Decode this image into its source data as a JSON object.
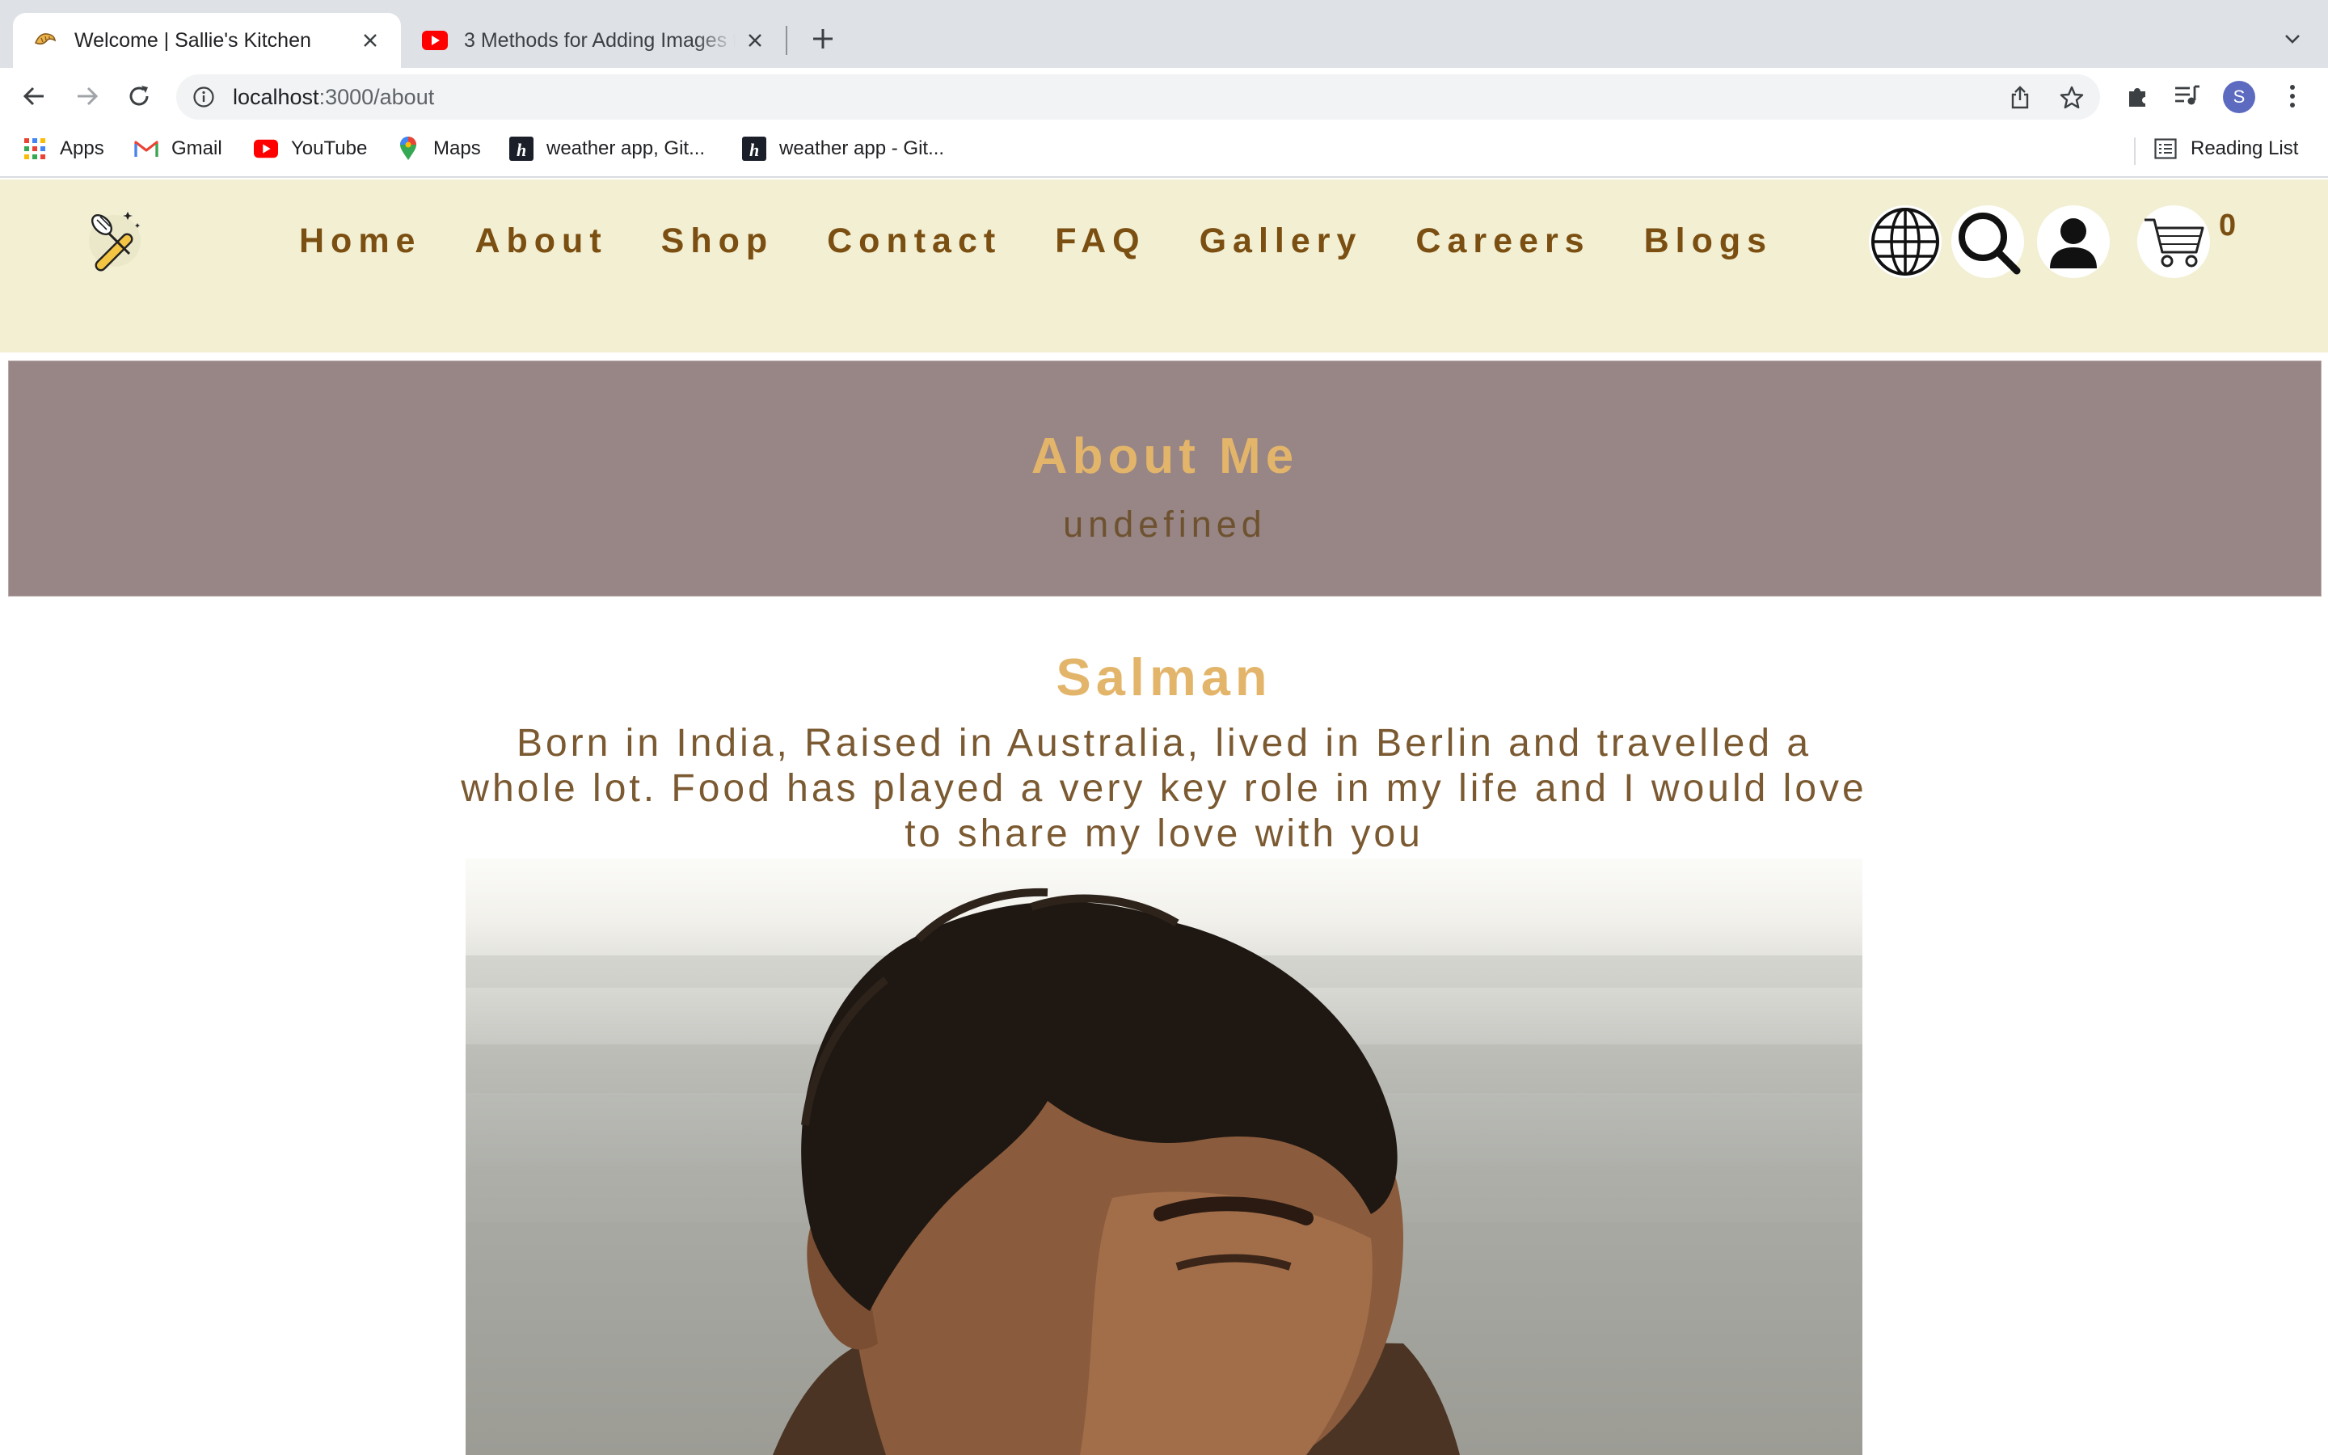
{
  "browser": {
    "tabs": [
      {
        "title": "Welcome | Sallie's Kitchen",
        "active": true,
        "icon": "croissant-icon"
      },
      {
        "title": "3 Methods for Adding Images t",
        "active": false,
        "icon": "youtube-icon"
      }
    ],
    "url_host": "localhost",
    "url_path": ":3000/about",
    "profile_initial": "S",
    "bookmarks": [
      {
        "label": "Apps",
        "icon": "apps-grid-icon"
      },
      {
        "label": "Gmail",
        "icon": "gmail-icon"
      },
      {
        "label": "YouTube",
        "icon": "youtube-icon"
      },
      {
        "label": "Maps",
        "icon": "maps-pin-icon"
      },
      {
        "label": "weather app, Git...",
        "icon": "hashnode-icon"
      },
      {
        "label": "weather app - Git...",
        "icon": "hashnode-icon"
      }
    ],
    "reading_list": "Reading List"
  },
  "site": {
    "nav": [
      "Home",
      "About",
      "Shop",
      "Contact",
      "FAQ",
      "Gallery",
      "Careers",
      "Blogs"
    ],
    "cart_count": "0",
    "colors": {
      "nav_bg": "#f2efd3",
      "nav_text": "#7b4f12",
      "hero_bg": "#988585",
      "accent": "#e3b56a"
    }
  },
  "hero": {
    "title": "About Me",
    "subtitle": "undefined"
  },
  "profile": {
    "name": "Salman",
    "bio": "Born in India, Raised in Australia, lived in Berlin and travelled a whole lot. Food has played a very key role in my life and I would love to share my love with you"
  }
}
